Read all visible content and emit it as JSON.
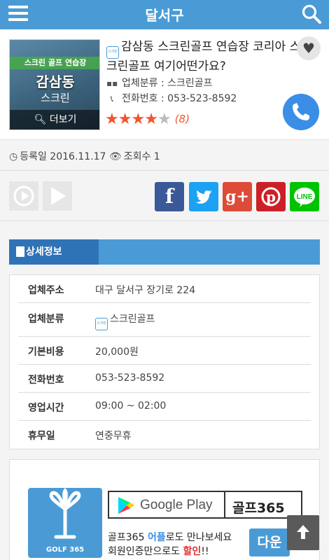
{
  "header": {
    "title": "달서구",
    "menu_icon": "menu-icon",
    "search_icon": "search-icon"
  },
  "listing": {
    "title": "감삼동 스크린골프 연습장 코리아 스크린골프 여기어떤가요?",
    "badge": "스크린",
    "thumb": {
      "band": "스크린 골프 연습장",
      "name": "감삼동",
      "sub": "스크린",
      "more": "더보기"
    },
    "category_label": "업체분류 : 스크린골프",
    "phone_label": "전화번호 : 053-523-8592",
    "rating": 4,
    "rating_max": 5,
    "review_count": "(8)",
    "heart": "♥"
  },
  "meta": {
    "registered": "등록일 2016.11.17",
    "views": "조회수 1"
  },
  "share": [
    "facebook",
    "twitter",
    "google-plus",
    "pinterest",
    "line"
  ],
  "share_text": {
    "facebook": "f",
    "google": "g+",
    "line": "LINE"
  },
  "detail": {
    "tab": "상세정보",
    "rows": [
      {
        "key": "업체주소",
        "value": "대구 달서구 장기로 224"
      },
      {
        "key": "업체분류",
        "value": "스크린골프"
      },
      {
        "key": "기본비용",
        "value": "20,000원"
      },
      {
        "key": "전화번호",
        "value": "053-523-8592"
      },
      {
        "key": "영업시간",
        "value": "09:00 ~ 02:00"
      },
      {
        "key": "휴무일",
        "value": "연중무휴"
      }
    ]
  },
  "banner": {
    "logo_label": "GOLF 365",
    "store": "Google Play",
    "app_name": "골프365",
    "line1_a": "골프365 ",
    "line1_b": "어플",
    "line1_c": "로도 만나보세요",
    "line2_a": "회원인증만으로도 ",
    "line2_b": "할인",
    "line2_c": "!!",
    "button": "다운"
  },
  "colors": {
    "primary": "#4a9bd5",
    "dark_tab": "#2f73b7",
    "star": "#f0552e",
    "call": "#3a8ee6"
  }
}
